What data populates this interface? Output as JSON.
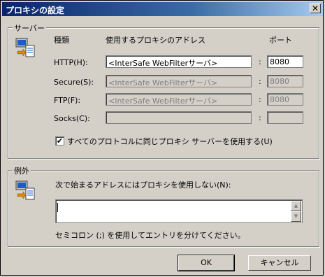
{
  "window": {
    "title": "プロキシの設定",
    "close_glyph": "✕"
  },
  "servers": {
    "legend": "サーバー",
    "col_type": "種類",
    "col_address": "使用するプロキシのアドレス",
    "col_port": "ポート",
    "rows": [
      {
        "label": "HTTP(H):",
        "address": "<InterSafe WebFilterサーバ>",
        "port": "8080",
        "enabled": true
      },
      {
        "label": "Secure(S):",
        "address": "<InterSafe WebFilterサーバ>",
        "port": "8080",
        "enabled": false
      },
      {
        "label": "FTP(F):",
        "address": "<InterSafe WebFilterサーバ>",
        "port": "8080",
        "enabled": false
      },
      {
        "label": "Socks(C):",
        "address": "",
        "port": "",
        "enabled": false
      }
    ],
    "colon": ":",
    "same_proxy": {
      "label": "すべてのプロトコルに同じプロキシ サーバーを使用する(U)",
      "checked": true,
      "check_glyph": "✔"
    }
  },
  "exceptions": {
    "legend": "例外",
    "prompt": "次で始まるアドレスにはプロキシを使用しない(N):",
    "value": "",
    "hint": "セミコロン (;) を使用してエントリを分けてください。"
  },
  "buttons": {
    "ok": "OK",
    "cancel": "キャンセル"
  }
}
